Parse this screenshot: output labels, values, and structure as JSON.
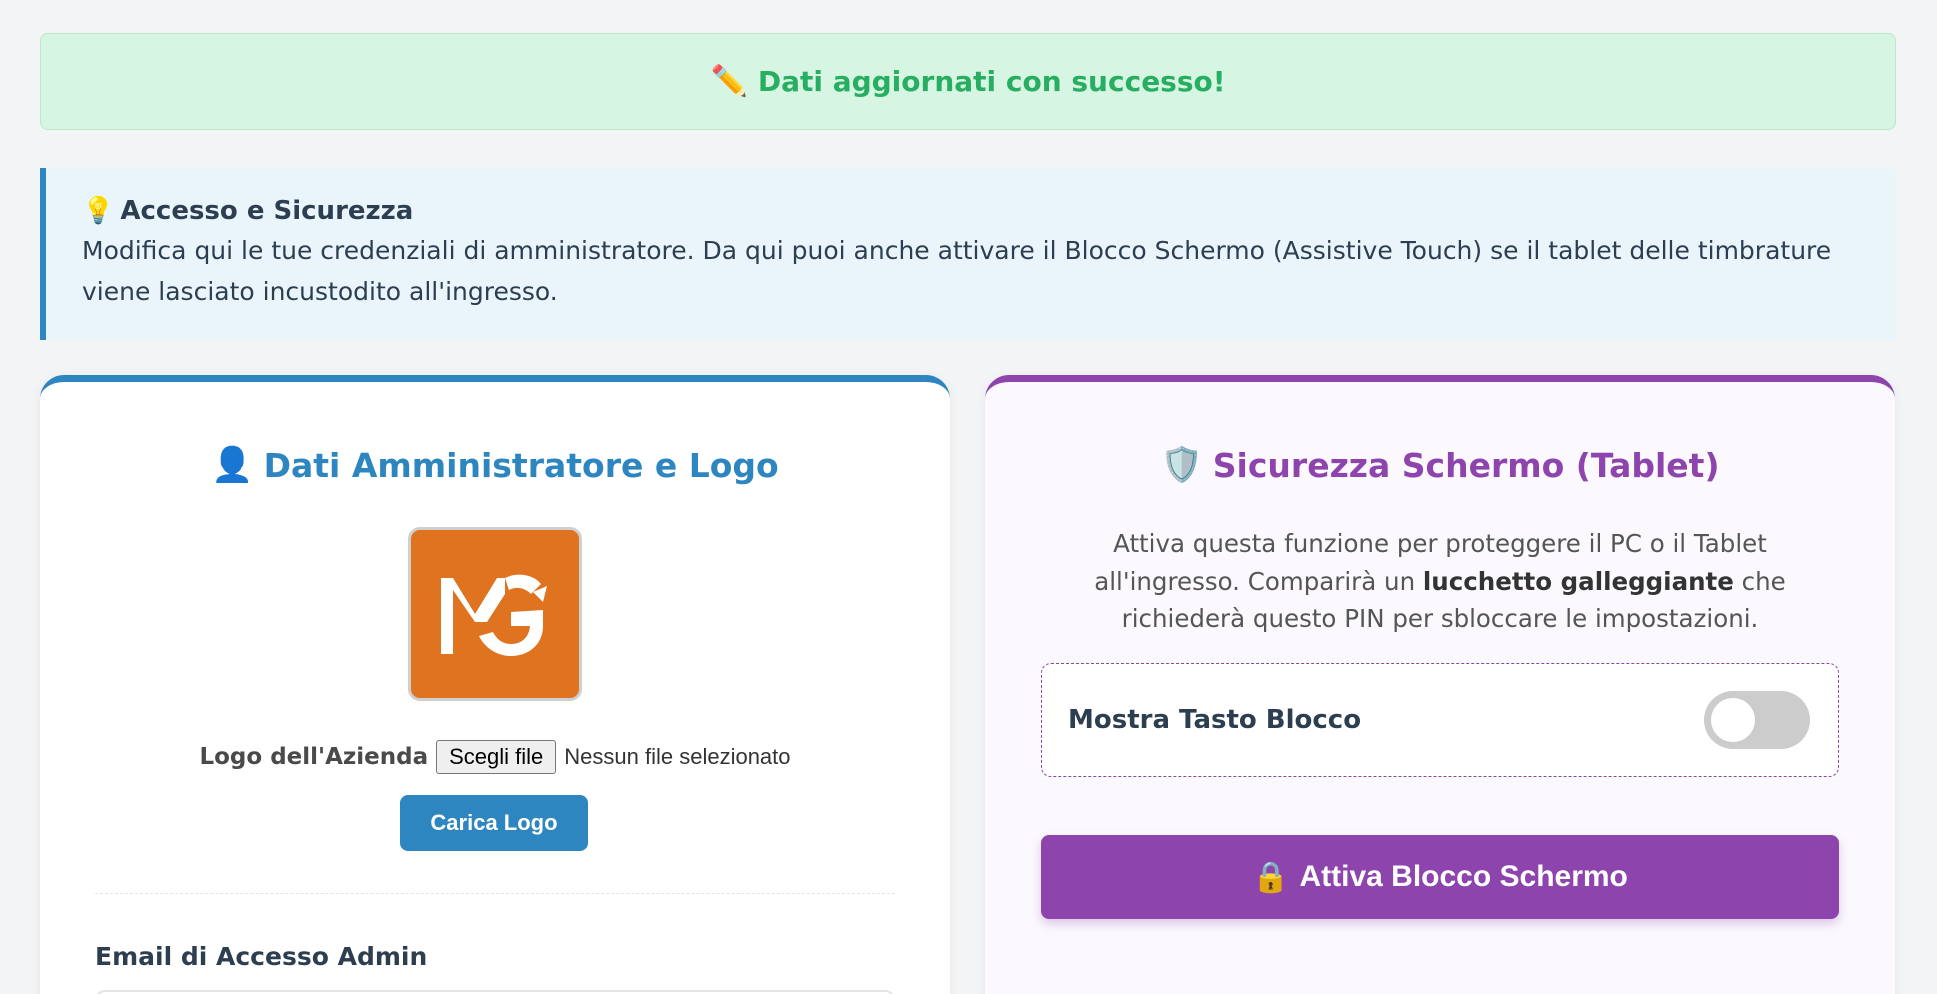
{
  "alert": {
    "icon": "pencil-icon",
    "emoji": "✏️",
    "message": "Dati aggiornati con successo!"
  },
  "info": {
    "icon": "lightbulb-icon",
    "emoji": "💡",
    "title": "Accesso e Sicurezza",
    "text": "Modifica qui le tue credenziali di amministratore. Da qui puoi anche attivare il Blocco Schermo (Assistive Touch) se il tablet delle timbrature viene lasciato incustodito all'ingresso."
  },
  "admin_card": {
    "icon": "user-icon",
    "emoji": "👤",
    "title": "Dati Amministratore e Logo",
    "logo_label": "Logo dell'Azienda",
    "file_button": "Scegli file",
    "file_status": "Nessun file selezionato",
    "upload_button": "Carica Logo",
    "email_label": "Email di Accesso Admin"
  },
  "security_card": {
    "icon": "shield-icon",
    "emoji": "🛡️",
    "title": "Sicurezza Schermo (Tablet)",
    "desc_part1": "Attiva questa funzione per proteggere il PC o il Tablet all'ingresso. Comparirà un ",
    "desc_bold": "lucchetto galleggiante",
    "desc_part2": " che richiederà questo PIN per sbloccare le impostazioni.",
    "toggle_label": "Mostra Tasto Blocco",
    "toggle_on": false,
    "lock_icon": "lock-icon",
    "lock_emoji": "🔒",
    "lock_button": "Attiva Blocco Schermo"
  },
  "colors": {
    "success_bg": "#d6f5e3",
    "success_text": "#27ae60",
    "primary_blue": "#2e86c1",
    "primary_purple": "#8e44ad",
    "logo_orange": "#e0731f"
  }
}
